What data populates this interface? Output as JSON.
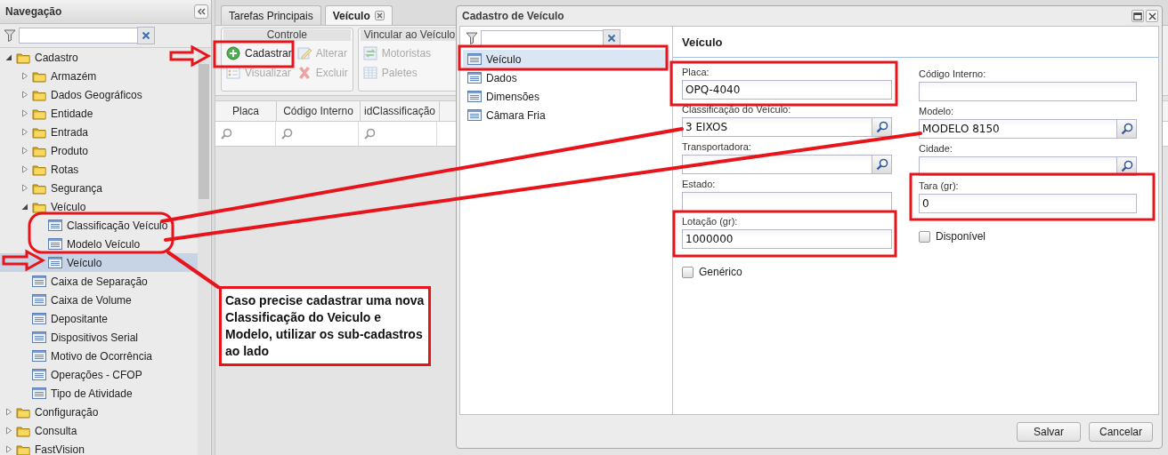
{
  "navigation": {
    "title": "Navegação",
    "tree": [
      {
        "label": "Cadastro",
        "kind": "folder",
        "expanded": true,
        "children": [
          {
            "label": "Armazém",
            "kind": "folder",
            "expanded": false
          },
          {
            "label": "Dados Geográficos",
            "kind": "folder",
            "expanded": false
          },
          {
            "label": "Entidade",
            "kind": "folder",
            "expanded": false
          },
          {
            "label": "Entrada",
            "kind": "folder",
            "expanded": false
          },
          {
            "label": "Produto",
            "kind": "folder",
            "expanded": false
          },
          {
            "label": "Rotas",
            "kind": "folder",
            "expanded": false
          },
          {
            "label": "Segurança",
            "kind": "folder",
            "expanded": false
          },
          {
            "label": "Veículo",
            "kind": "folder",
            "expanded": true,
            "children": [
              {
                "label": "Classificação Veículo",
                "kind": "form",
                "selected": false
              },
              {
                "label": "Modelo Veículo",
                "kind": "form",
                "selected": false
              },
              {
                "label": "Veículo",
                "kind": "form",
                "selected": true
              }
            ]
          },
          {
            "label": "Caixa de Separação",
            "kind": "form",
            "selected": false
          },
          {
            "label": "Caixa de Volume",
            "kind": "form",
            "selected": false
          },
          {
            "label": "Depositante",
            "kind": "form",
            "selected": false
          },
          {
            "label": "Dispositivos Serial",
            "kind": "form",
            "selected": false
          },
          {
            "label": "Motivo de Ocorrência",
            "kind": "form",
            "selected": false
          },
          {
            "label": "Operações - CFOP",
            "kind": "form",
            "selected": false
          },
          {
            "label": "Tipo de Atividade",
            "kind": "form",
            "selected": false
          }
        ]
      },
      {
        "label": "Configuração",
        "kind": "folder",
        "expanded": false
      },
      {
        "label": "Consulta",
        "kind": "folder",
        "expanded": false
      },
      {
        "label": "FastVision",
        "kind": "folder",
        "expanded": false
      }
    ]
  },
  "tabs": [
    {
      "label": "Tarefas Principais",
      "selected": false,
      "closable": false
    },
    {
      "label": "Veículo",
      "selected": true,
      "closable": true
    }
  ],
  "toolbar_groups": [
    {
      "title": "Controle",
      "buttons": [
        {
          "label": "Cadastrar",
          "disabled": false
        },
        {
          "label": "Alterar",
          "disabled": true
        },
        {
          "label": "Visualizar",
          "disabled": true
        },
        {
          "label": "Excluir",
          "disabled": true
        }
      ]
    },
    {
      "title": "Vincular ao Veículo",
      "buttons": [
        {
          "label": "Motoristas",
          "disabled": true
        },
        {
          "label": "Paletes",
          "disabled": true
        }
      ]
    }
  ],
  "grid": {
    "columns": [
      "Placa",
      "Código Interno",
      "idClassificação"
    ]
  },
  "dialog": {
    "title": "Cadastro de Veículo",
    "sections": [
      {
        "label": "Veículo",
        "selected": true
      },
      {
        "label": "Dados",
        "selected": false
      },
      {
        "label": "Dimensões",
        "selected": false
      },
      {
        "label": "Câmara Fria",
        "selected": false
      }
    ],
    "heading": "Veículo",
    "left_fields": [
      {
        "kind": "text",
        "label": "Placa:",
        "value": "OPQ-4040"
      },
      {
        "kind": "lookup",
        "label": "Classificação do Veículo:",
        "value": "3 EIXOS"
      },
      {
        "kind": "lookup",
        "label": "Transportadora:"
      },
      {
        "kind": "text",
        "label": "Estado:"
      },
      {
        "kind": "text",
        "label": "Lotação (gr):",
        "value": "1000000"
      },
      {
        "kind": "checkbox",
        "label": "Genérico",
        "checked": false
      }
    ],
    "right_fields": [
      {
        "kind": "text",
        "label": "Código Interno:"
      },
      {
        "kind": "lookup",
        "label": "Modelo:",
        "value": "MODELO 8150"
      },
      {
        "kind": "lookup",
        "label": "Cidade:"
      },
      {
        "kind": "text",
        "label": "Tara (gr):",
        "value": "0"
      },
      {
        "kind": "checkbox",
        "label": "Disponível",
        "checked": false
      }
    ],
    "buttons": [
      "Salvar",
      "Cancelar"
    ]
  },
  "annotation": {
    "callout": "Caso precise cadastrar uma nova Classificação do Veiculo e Modelo, utilizar os sub-cadastros ao lado"
  }
}
